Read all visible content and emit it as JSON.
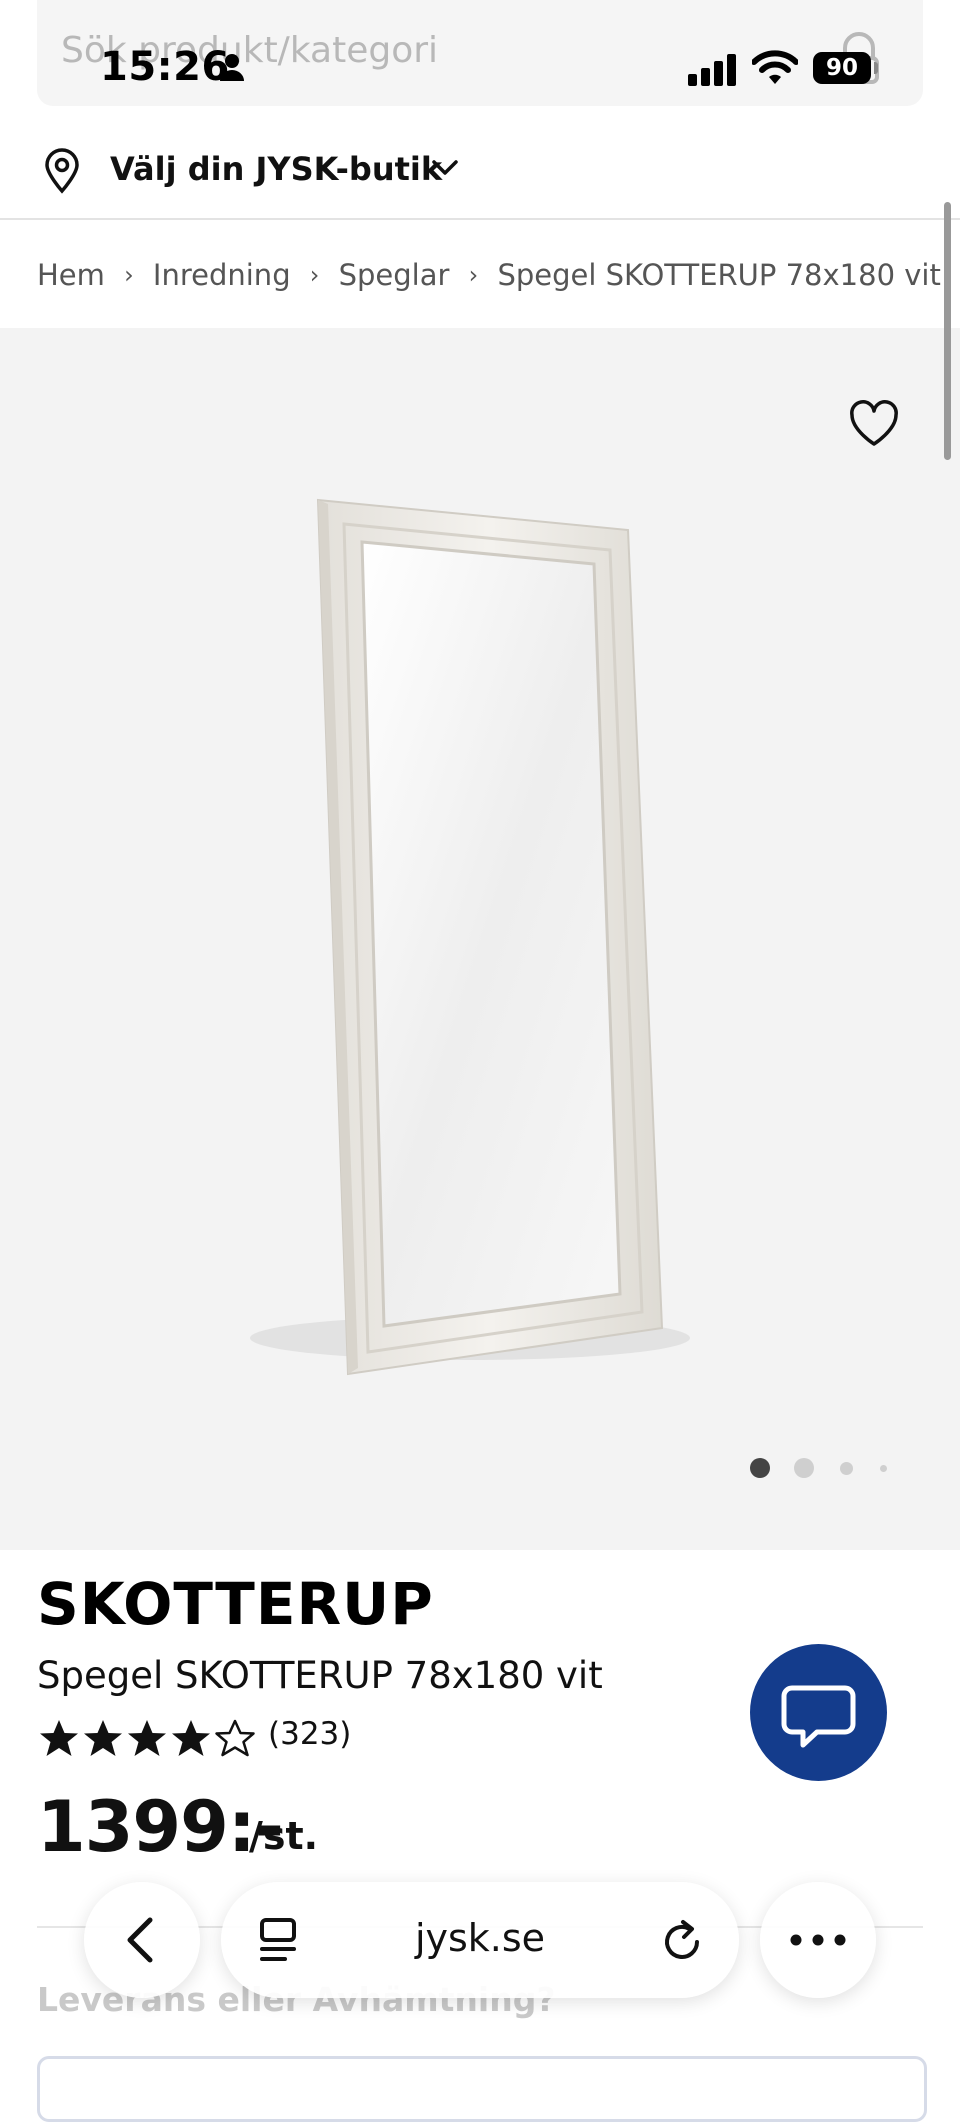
{
  "status_bar": {
    "time": "15:26",
    "battery": "90"
  },
  "search": {
    "placeholder": "Sök produkt/kategori"
  },
  "store": {
    "label": "Välj din JYSK-butik"
  },
  "breadcrumb": [
    "Hem",
    "Inredning",
    "Speglar",
    "Spegel SKOTTERUP 78x180 vit"
  ],
  "gallery": {
    "image_count": 4,
    "active_index": 0
  },
  "product": {
    "brand": "SKOTTERUP",
    "name": "Spegel SKOTTERUP 78x180 vit",
    "rating": 4,
    "rating_max": 5,
    "review_count": "(323)",
    "price": "1399:-",
    "unit": "/st."
  },
  "delivery": {
    "label": "Leverans eller Avhämtning?"
  },
  "browser": {
    "url": "jysk.se"
  },
  "colors": {
    "chat_button": "#143c8c",
    "image_bg": "#f3f3f3"
  }
}
